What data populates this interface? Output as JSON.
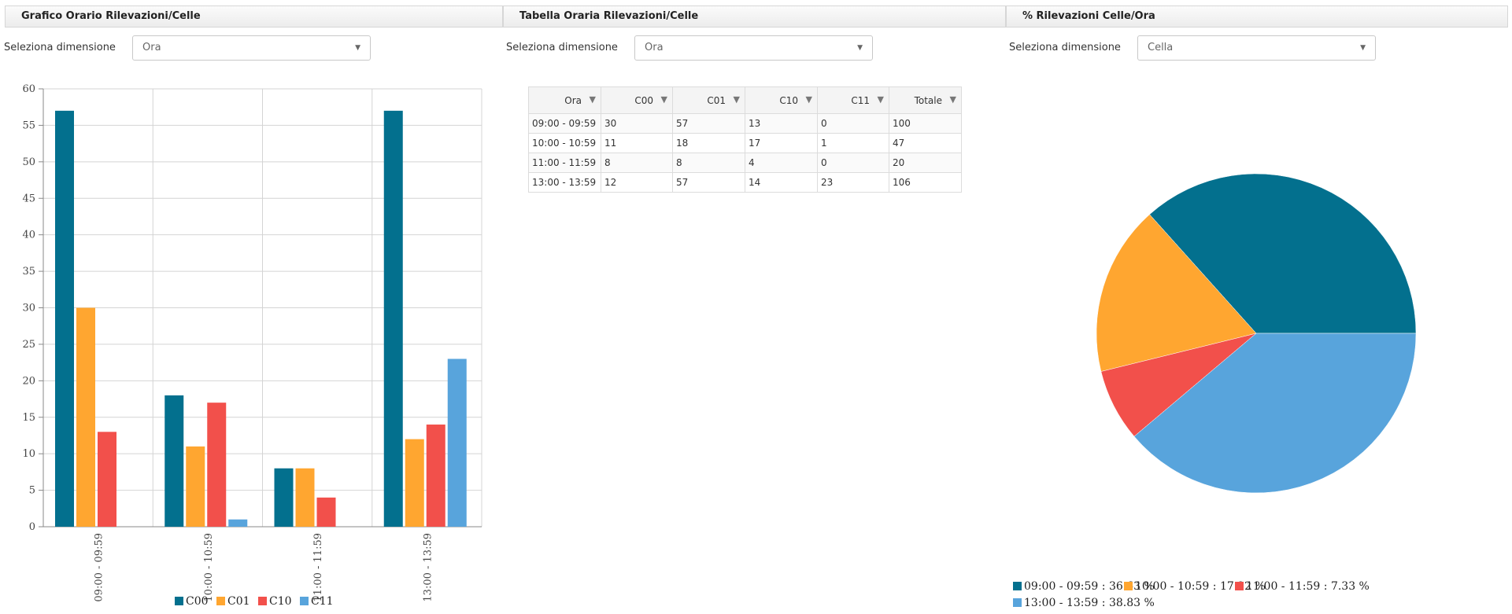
{
  "panels": [
    {
      "title": "Grafico Orario Rilevazioni/Celle"
    },
    {
      "title": "Tabella Oraria Rilevazioni/Celle"
    },
    {
      "title": "% Rilevazioni Celle/Ora"
    }
  ],
  "dimension_label": "Seleziona dimensione",
  "selects": [
    "Ora",
    "Ora",
    "Cella"
  ],
  "table": {
    "headers": [
      "Ora",
      "C00",
      "C01",
      "C10",
      "C11",
      "Totale"
    ],
    "rows": [
      [
        "09:00 - 09:59",
        "30",
        "57",
        "13",
        "0",
        "100"
      ],
      [
        "10:00 - 10:59",
        "11",
        "18",
        "17",
        "1",
        "47"
      ],
      [
        "11:00 - 11:59",
        "8",
        "8",
        "4",
        "0",
        "20"
      ],
      [
        "13:00 - 13:59",
        "12",
        "57",
        "14",
        "23",
        "106"
      ]
    ]
  },
  "chart_data": [
    {
      "type": "bar",
      "categories": [
        "09:00 - 09:59",
        "10:00 - 10:59",
        "11:00 - 11:59",
        "13:00 - 13:59"
      ],
      "series": [
        {
          "name": "C00",
          "color": "#03708e",
          "values": [
            57,
            18,
            8,
            57
          ]
        },
        {
          "name": "C01",
          "color": "#ffa630",
          "values": [
            30,
            11,
            8,
            12
          ]
        },
        {
          "name": "C10",
          "color": "#f2504b",
          "values": [
            13,
            17,
            4,
            14
          ]
        },
        {
          "name": "C11",
          "color": "#58a4dc",
          "values": [
            0,
            1,
            0,
            23
          ]
        }
      ],
      "ylim": [
        0,
        60
      ],
      "yticks": [
        0,
        5,
        10,
        15,
        20,
        25,
        30,
        35,
        40,
        45,
        50,
        55,
        60
      ],
      "grid": true,
      "legend": "bottom"
    },
    {
      "type": "pie",
      "slices": [
        {
          "label": "09:00 - 09:59 : 36.63 %",
          "value": 36.63,
          "color": "#03708e"
        },
        {
          "label": "10:00 - 10:59 : 17.22 %",
          "value": 17.22,
          "color": "#ffa630"
        },
        {
          "label": "11:00 - 11:59 : 7.33 %",
          "value": 7.33,
          "color": "#f2504b"
        },
        {
          "label": "13:00 - 13:59 : 38.83 %",
          "value": 38.83,
          "color": "#58a4dc"
        }
      ],
      "legend": "bottom"
    }
  ]
}
